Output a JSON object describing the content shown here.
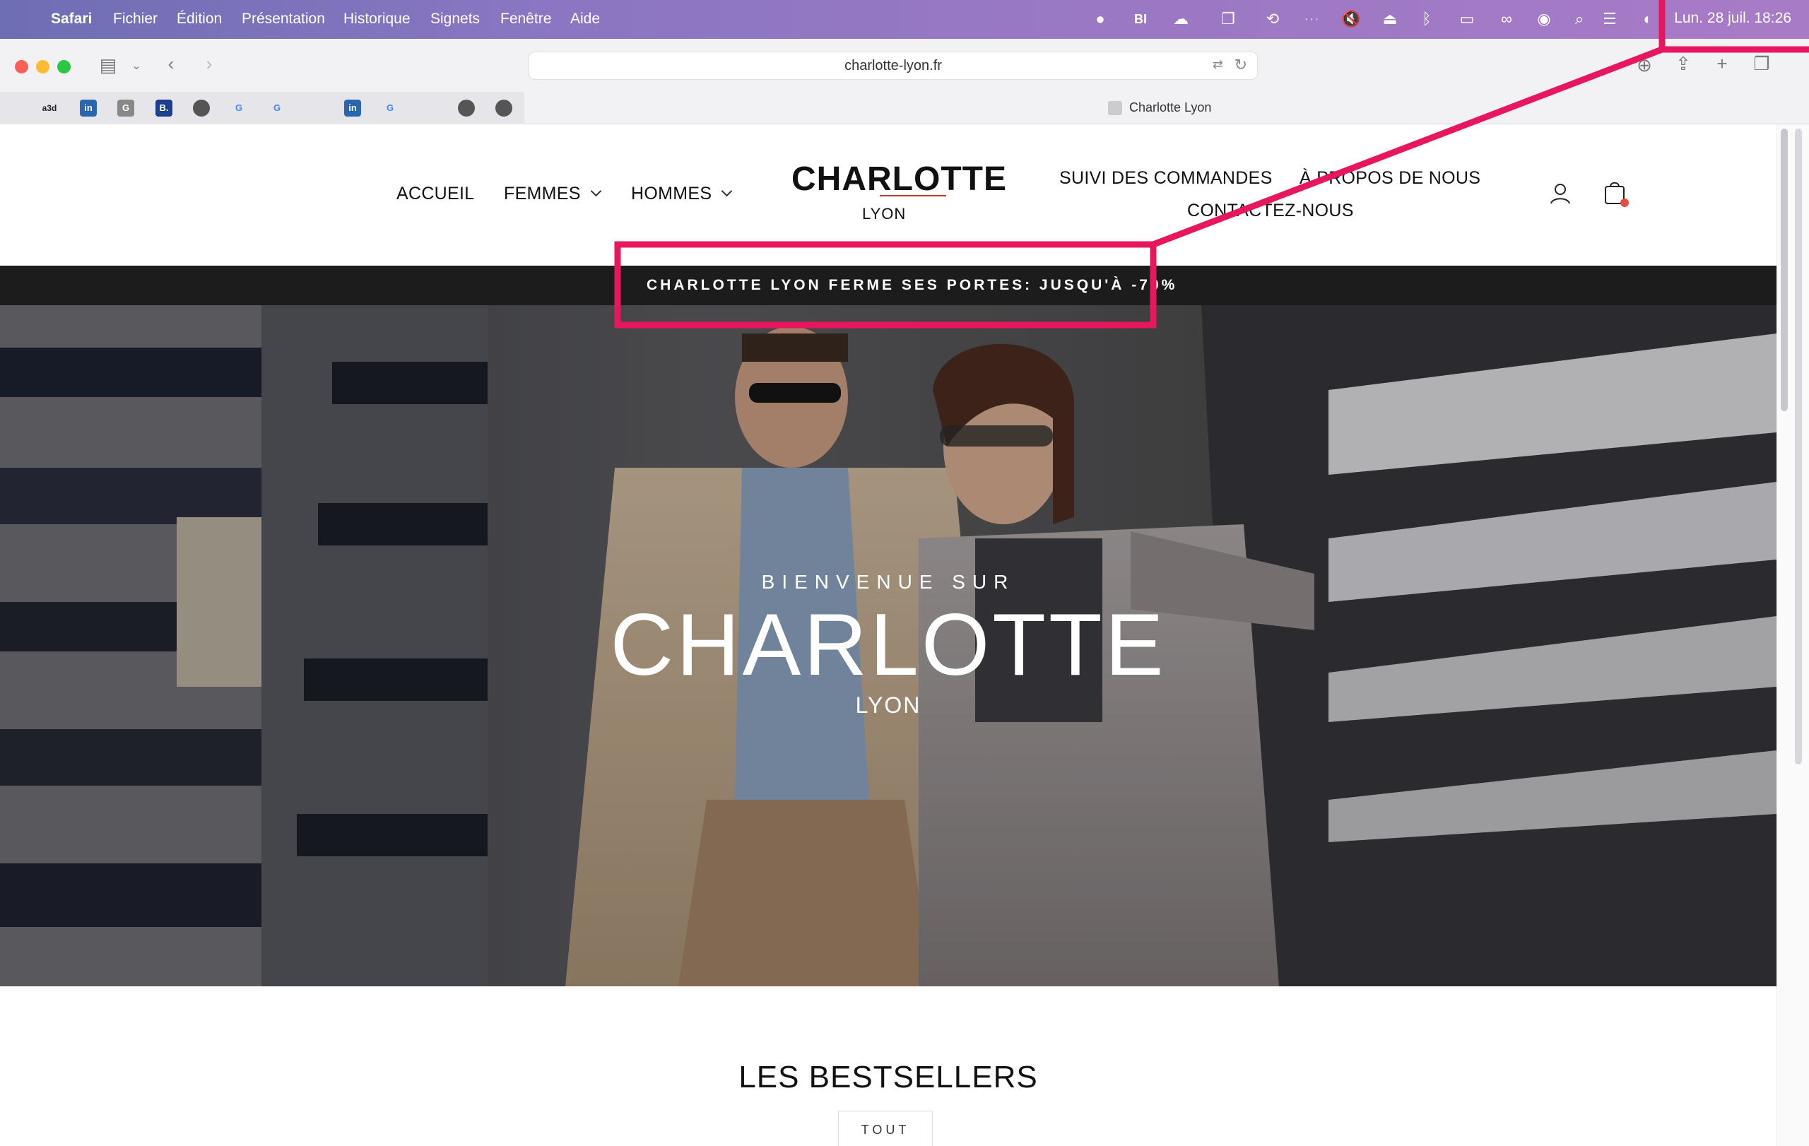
{
  "menubar": {
    "app_name": "Safari",
    "items": [
      "Fichier",
      "Édition",
      "Présentation",
      "Historique",
      "Signets",
      "Fenêtre",
      "Aide"
    ],
    "clock": "Lun. 28 juil.  18:26"
  },
  "browser": {
    "url": "charlotte-lyon.fr",
    "tab_title": "Charlotte Lyon"
  },
  "bookmarks": [
    {
      "icon": "bookmark-x-icon",
      "label": ""
    },
    {
      "icon": "bookmark-a3d-icon",
      "label": "a3d"
    },
    {
      "icon": "linkedin-icon",
      "label": "in"
    },
    {
      "icon": "bookmark-g-icon",
      "label": "G"
    },
    {
      "icon": "booking-icon",
      "label": "B."
    },
    {
      "icon": "profile-icon",
      "label": ""
    },
    {
      "icon": "google-icon",
      "label": "G"
    },
    {
      "icon": "google-icon",
      "label": "G"
    },
    {
      "icon": "bookmark-x-icon",
      "label": ""
    },
    {
      "icon": "linkedin-icon",
      "label": "in"
    },
    {
      "icon": "google-icon",
      "label": "G"
    },
    {
      "icon": "bookmark-dash-icon",
      "label": ""
    },
    {
      "icon": "profile-icon",
      "label": ""
    },
    {
      "icon": "profile-icon",
      "label": ""
    }
  ],
  "site": {
    "nav_left": [
      "ACCUEIL",
      "FEMMES",
      "HOMMES"
    ],
    "logo_main": "CHARLOTTE",
    "logo_sub": "LYON",
    "nav_right": [
      "SUIVI DES COMMANDES",
      "À PROPOS DE NOUS",
      "CONTACTEZ-NOUS"
    ],
    "announcement": "CHARLOTTE LYON FERME SES PORTES: JUSQU'À -70%",
    "hero": {
      "kicker": "BIENVENUE SUR",
      "title": "CHARLOTTE",
      "subtitle": "LYON"
    },
    "section_title": "LES BESTSELLERS",
    "filter_button": "TOUT"
  },
  "colors": {
    "annotation": "#e8175d",
    "announcement_bg": "#1c1c1c",
    "logo_accent": "#c0392b"
  }
}
